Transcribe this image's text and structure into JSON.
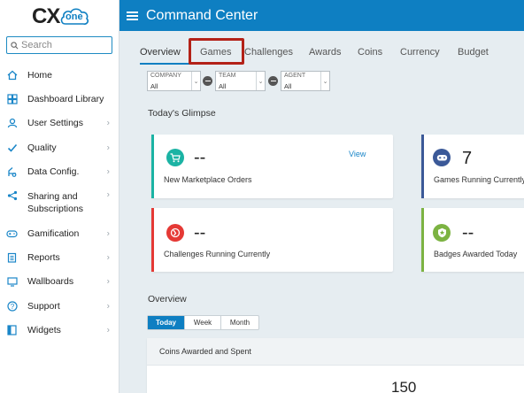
{
  "logo": {
    "cx": "CX",
    "one": "one"
  },
  "search": {
    "placeholder": "Search"
  },
  "sidebar": {
    "items": [
      {
        "label": "Home",
        "icon": "home-icon",
        "chevron": false
      },
      {
        "label": "Dashboard Library",
        "icon": "dashboard-icon",
        "chevron": false
      },
      {
        "label": "User Settings",
        "icon": "user-icon",
        "chevron": true
      },
      {
        "label": "Quality",
        "icon": "checkmark-icon",
        "chevron": true
      },
      {
        "label": "Data Config.",
        "icon": "data-config-icon",
        "chevron": true
      },
      {
        "label": "Sharing and Subscriptions",
        "icon": "share-icon",
        "chevron": true
      },
      {
        "label": "Gamification",
        "icon": "gamepad-icon",
        "chevron": true
      },
      {
        "label": "Reports",
        "icon": "reports-icon",
        "chevron": true
      },
      {
        "label": "Wallboards",
        "icon": "monitor-icon",
        "chevron": true
      },
      {
        "label": "Support",
        "icon": "help-icon",
        "chevron": true
      },
      {
        "label": "Widgets",
        "icon": "widgets-icon",
        "chevron": true
      }
    ]
  },
  "header": {
    "title": "Command Center"
  },
  "tabs": [
    {
      "label": "Overview",
      "active": true
    },
    {
      "label": "Games",
      "active": false
    },
    {
      "label": "Challenges",
      "active": false
    },
    {
      "label": "Awards",
      "active": false
    },
    {
      "label": "Coins",
      "active": false
    },
    {
      "label": "Currency",
      "active": false
    },
    {
      "label": "Budget",
      "active": false
    }
  ],
  "filters": [
    {
      "label": "COMPANY",
      "value": "All"
    },
    {
      "label": "TEAM",
      "value": "All"
    },
    {
      "label": "AGENT",
      "value": "All"
    }
  ],
  "glimpse": {
    "title": "Today's Glimpse",
    "cards": [
      {
        "value": "--",
        "label": "New Marketplace Orders",
        "link": "View",
        "icon": "cart-icon",
        "accent": "#1bb3a4"
      },
      {
        "value": "7",
        "label": "Games Running Currently",
        "icon": "gamepad-icon",
        "accent": "#3b5998"
      },
      {
        "value": "--",
        "label": "Challenges Running Currently",
        "icon": "challenge-icon",
        "accent": "#e53935"
      },
      {
        "value": "--",
        "label": "Badges Awarded Today",
        "icon": "badge-icon",
        "accent": "#7cb342"
      }
    ]
  },
  "overview": {
    "title": "Overview",
    "range": [
      "Today",
      "Week",
      "Month"
    ],
    "range_selected": "Today",
    "panel_title": "Coins Awarded and Spent",
    "panel_value": "150"
  },
  "colors": {
    "brand": "#0e7fc2",
    "highlight": "#b32218"
  }
}
